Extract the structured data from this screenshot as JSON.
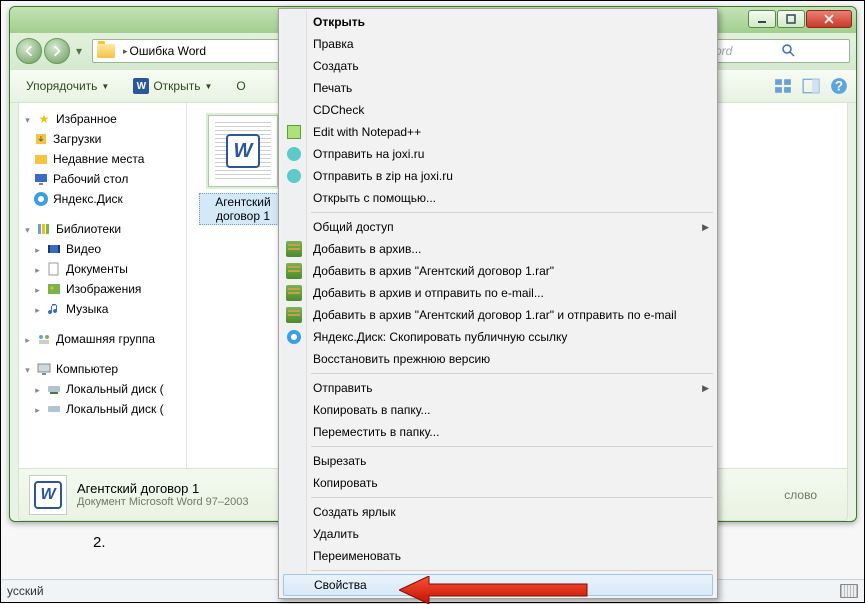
{
  "window": {
    "path_segment": "Ошибка Word",
    "search_suffix": "ord"
  },
  "toolbar": {
    "organize": "Упорядочить",
    "open": "Открыть",
    "extra": "О"
  },
  "sidebar": {
    "favorites": "Избранное",
    "downloads": "Загрузки",
    "recent": "Недавние места",
    "desktop": "Рабочий стол",
    "yadisk": "Яндекс.Диск",
    "libraries": "Библиотеки",
    "video": "Видео",
    "documents": "Документы",
    "pictures": "Изображения",
    "music": "Музыка",
    "homegroup": "Домашняя группа",
    "computer": "Компьютер",
    "disk_c": "Локальный диск (",
    "disk_d": "Локальный диск ("
  },
  "file": {
    "name_l1": "Агентский",
    "name_l2": "договор 1"
  },
  "details": {
    "title": "Агентский договор 1",
    "type": "Документ Microsoft Word 97–2003",
    "extra": "слово"
  },
  "ctx": {
    "open": "Открыть",
    "edit": "Правка",
    "create": "Создать",
    "print": "Печать",
    "cdcheck": "CDCheck",
    "npp": "Edit with Notepad++",
    "joxi1": "Отправить на joxi.ru",
    "joxi2": "Отправить в zip на joxi.ru",
    "openwith": "Открыть с помощью...",
    "share": "Общий доступ",
    "rar1": "Добавить в архив...",
    "rar2": "Добавить в архив \"Агентский договор 1.rar\"",
    "rar3": "Добавить в архив и отправить по e-mail...",
    "rar4": "Добавить в архив \"Агентский договор 1.rar\" и отправить по e-mail",
    "yadisk": "Яндекс.Диск: Скопировать публичную ссылку",
    "restore": "Восстановить прежнюю версию",
    "sendto": "Отправить",
    "copyto": "Копировать в папку...",
    "moveto": "Переместить в папку...",
    "cut": "Вырезать",
    "copy": "Копировать",
    "shortcut": "Создать ярлык",
    "delete": "Удалить",
    "rename": "Переименовать",
    "props": "Свойства"
  },
  "footer": {
    "num": "2.",
    "lang": "усский"
  }
}
